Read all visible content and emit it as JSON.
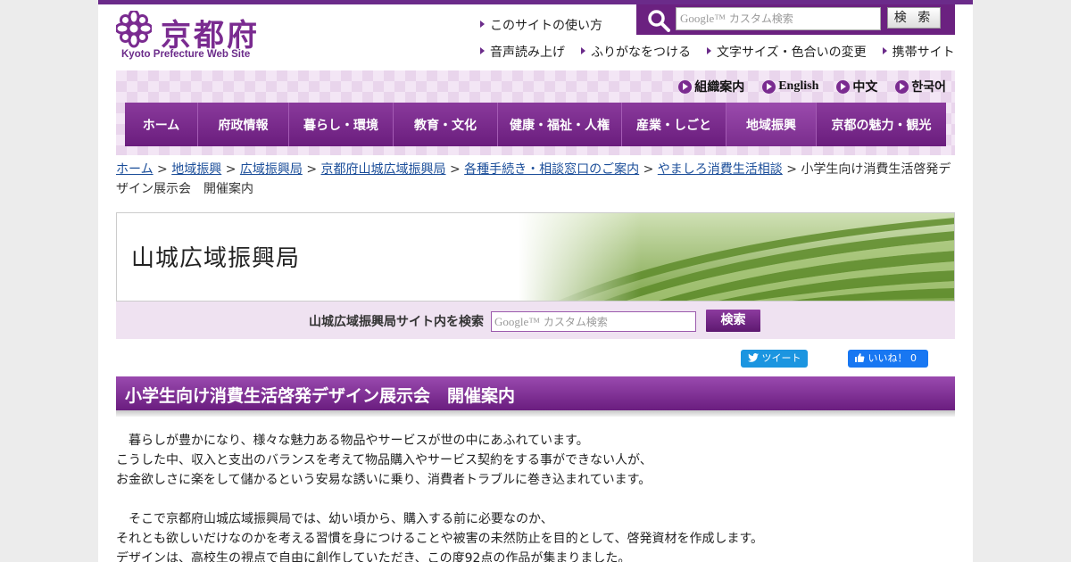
{
  "site": {
    "logo_text": "京都府",
    "logo_sub": "Kyoto Prefecture Web Site",
    "brand_color": "#6b2b8a"
  },
  "header": {
    "search_placeholder": "カスタム検索",
    "search_button": "検 索",
    "util_top": "このサイトの使い方",
    "util_links": [
      "音声読み上げ",
      "ふりがなをつける",
      "文字サイズ・色合いの変更",
      "携帯サイト"
    ]
  },
  "languages": [
    "組織案内",
    "English",
    "中文",
    "한국어"
  ],
  "nav": {
    "items": [
      "ホーム",
      "府政情報",
      "暮らし・環境",
      "教育・文化",
      "健康・福祉・人権",
      "産業・しごと",
      "地域振興",
      "京都の魅力・観光"
    ],
    "active": "地域振興"
  },
  "breadcrumb": {
    "links": [
      "ホーム",
      "地域振興",
      "広域振興局",
      "京都府山城広域振興局",
      "各種手続き・相談窓口のご案内",
      "やましろ消費生活相談"
    ],
    "separator": ">",
    "current": "小学生向け消費生活啓発デザイン展示会　開催案内"
  },
  "banner": {
    "title": "山城広域振興局"
  },
  "sub_search": {
    "label": "山城広域振興局サイト内を検索",
    "placeholder": "カスタム検索",
    "button": "検索"
  },
  "social": {
    "tweet": "ツイート",
    "like": "いいね！ 0"
  },
  "article": {
    "title": "小学生向け消費生活啓発デザイン展示会　開催案内",
    "paragraphs": [
      "　暮らしが豊かになり、様々な魅力ある物品やサービスが世の中にあふれています。\nこうした中、収入と支出のバランスを考えて物品購入やサービス契約をする事ができない人が、\nお金欲しさに楽をして儲かるという安易な誘いに乗り、消費者トラブルに巻き込まれています。",
      "　そこで京都府山城広域振興局では、幼い頃から、購入する前に必要なのか、\nそれとも欲しいだけなのかを考える習慣を身につけることや被害の未然防止を目的として、啓発資材を作成します。\nデザインは、高校生の視点で自由に創作していただき、この度92点の作品が集まりました。"
    ]
  }
}
